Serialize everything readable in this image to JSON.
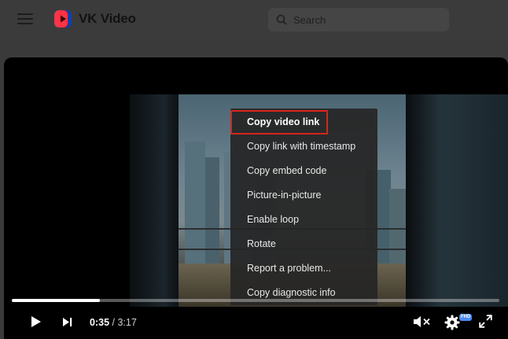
{
  "app": {
    "name": "VK Video"
  },
  "search": {
    "placeholder": "Search"
  },
  "context_menu": {
    "items": [
      {
        "label": "Copy video link",
        "highlighted": true
      },
      {
        "label": "Copy link with timestamp"
      },
      {
        "label": "Copy embed code"
      },
      {
        "label": "Picture-in-picture"
      },
      {
        "label": "Enable loop"
      },
      {
        "label": "Rotate"
      },
      {
        "label": "Report a problem..."
      },
      {
        "label": "Copy diagnostic info"
      }
    ]
  },
  "player": {
    "current_time": "0:35",
    "separator": "/",
    "duration": "3:17",
    "progress_fraction": 0.18,
    "quality_badge": "FHD",
    "icons": [
      "play-icon",
      "next-icon",
      "mute-icon",
      "settings-gear-icon",
      "fullscreen-icon"
    ]
  },
  "colors": {
    "accent_highlight": "#d8251a",
    "badge": "#4b8bf0",
    "logo_red": "#ff3347"
  }
}
